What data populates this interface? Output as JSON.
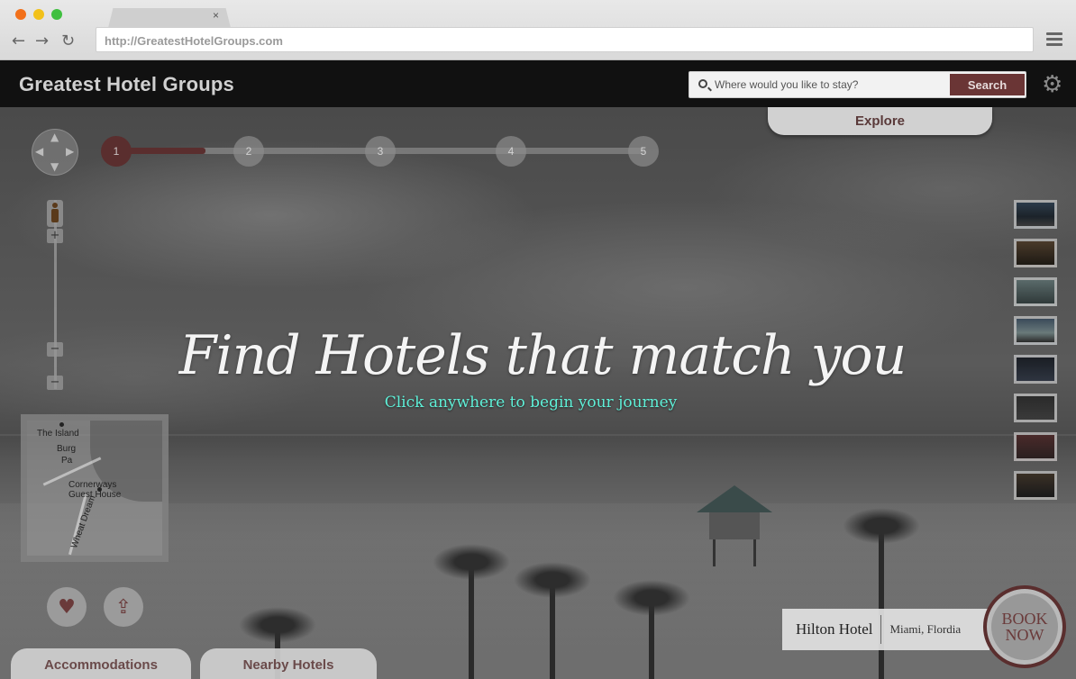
{
  "browser": {
    "url": "http://GreatestHotelGroups.com",
    "tab_close": "×",
    "back_icon": "arrow-left",
    "forward_icon": "arrow-right",
    "reload_icon": "reload"
  },
  "header": {
    "brand": "Greatest Hotel Groups",
    "search_placeholder": "Where would you like to stay?",
    "search_button": "Search",
    "settings_icon": "gear-icon"
  },
  "explore_label": "Explore",
  "steps": [
    "1",
    "2",
    "3",
    "4",
    "5"
  ],
  "current_step": 1,
  "zoom": {
    "plus": "+",
    "minus": "−"
  },
  "minimap": {
    "labels": [
      "The Island",
      "Burg",
      "Pa",
      "Cornerways",
      "Guest House",
      "Wheat Dream"
    ]
  },
  "hero": {
    "headline": "Find Hotels that match you",
    "subline": "Click anywhere to begin your journey",
    "accent_color": "#5ff0d8"
  },
  "actions": {
    "favorite_icon": "heart-icon",
    "share_icon": "share-icon"
  },
  "bottom_tabs": [
    "Accommodations",
    "Nearby Hotels"
  ],
  "hotel": {
    "name": "Hilton Hotel",
    "location": "Miami, Flordia"
  },
  "book": {
    "line1": "BOOK",
    "line2": "NOW"
  },
  "colors": {
    "brand": "#5a2e2e",
    "header_bg": "#111111"
  }
}
